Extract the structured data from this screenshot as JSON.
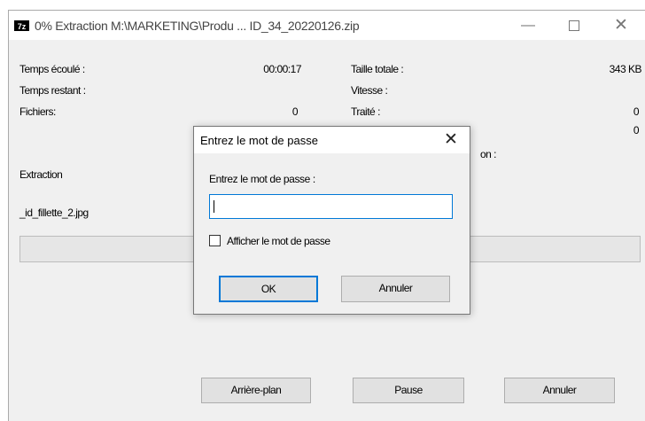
{
  "window": {
    "app_icon_text": "7z",
    "title": "0% Extraction M:\\MARKETING\\Produ ... ID_34_20220126.zip",
    "minimize_glyph": "—",
    "close_glyph": "✕"
  },
  "stats": {
    "elapsed_label": "Temps écoulé :",
    "elapsed_value": "00:00:17",
    "remaining_label": "Temps restant :",
    "remaining_value": "",
    "files_label": "Fichiers:",
    "files_value": "0",
    "total_size_label": "Taille totale :",
    "total_size_value": "343 KB",
    "speed_label": "Vitesse :",
    "speed_value": "",
    "processed_label": "Traité :",
    "processed_value": "0",
    "compressed_partial_label": "on :",
    "compressed_value": "0"
  },
  "operation_label": "Extraction",
  "current_file": "_id_fillette_2.jpg",
  "progress": {
    "percent": 0
  },
  "buttons": {
    "background": "Arrière-plan",
    "pause": "Pause",
    "cancel": "Annuler"
  },
  "dialog": {
    "title": "Entrez le mot de passe",
    "close_glyph": "✕",
    "prompt": "Entrez le mot de passe :",
    "password_value": "",
    "show_password_label": "Afficher le mot de passe",
    "show_password_checked": false,
    "ok": "OK",
    "cancel": "Annuler"
  },
  "colors": {
    "window_bg": "#f0f0f0",
    "accent": "#0078d7",
    "button_bg": "#e1e1e1"
  },
  "icons": [
    "app-7zip-icon",
    "minimize-icon",
    "maximize-icon",
    "close-icon",
    "dialog-close-icon"
  ]
}
